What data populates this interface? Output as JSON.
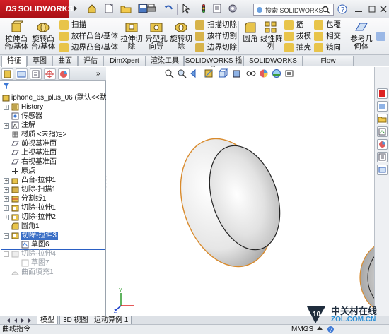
{
  "app": {
    "logo_ds": "DS",
    "logo_name": "SOLIDWORKS"
  },
  "search": {
    "placeholder": "搜索 SOLIDWORKS"
  },
  "ribbon": {
    "extrude_boss": "拉伸凸\n台/基体",
    "revolve_boss": "旋转凸\n台/基体",
    "sweep": "扫描",
    "loft": "放样凸台/基体",
    "boundary_boss": "边界凸台/基体",
    "extrude_cut": "拉伸切\n除",
    "hole_wizard": "异型孔\n向导",
    "revolve_cut": "旋转切\n除",
    "swept_cut": "扫描切除",
    "lofted_cut": "放样切割",
    "boundary_cut": "边界切除",
    "fillet": "圆角",
    "linear_pattern": "线性阵\n列",
    "rib": "筋",
    "draft": "拔模",
    "shell": "抽壳",
    "wrap": "包覆",
    "intersect": "相交",
    "mirror": "镜向",
    "ref_geometry": "参考几\n何体"
  },
  "tabs": [
    "特征",
    "草图",
    "曲面",
    "评估",
    "DimXpert",
    "渲染工具",
    "SOLIDWORKS 插件",
    "SOLIDWORKS MBD",
    "Flow Simulation"
  ],
  "tree": {
    "root": "iphone_6s_plus_06  (默认<<默认",
    "items": [
      {
        "label": "History",
        "icon": "history-icon"
      },
      {
        "label": "传感器",
        "icon": "sensor-icon"
      },
      {
        "label": "注解",
        "icon": "annotation-icon"
      },
      {
        "label": "材质 <未指定>",
        "icon": "material-icon"
      },
      {
        "label": "前视基准面",
        "icon": "plane-icon"
      },
      {
        "label": "上视基准面",
        "icon": "plane-icon"
      },
      {
        "label": "右视基准面",
        "icon": "plane-icon"
      },
      {
        "label": "原点",
        "icon": "origin-icon"
      },
      {
        "label": "凸台-拉伸1",
        "icon": "extrude-icon"
      },
      {
        "label": "切除-扫描1",
        "icon": "sweep-cut-icon"
      },
      {
        "label": "分割线1",
        "icon": "split-line-icon"
      },
      {
        "label": "切除-拉伸1",
        "icon": "cut-extrude-icon"
      },
      {
        "label": "切除-拉伸2",
        "icon": "cut-extrude-icon"
      },
      {
        "label": "圆角1",
        "icon": "fillet-icon"
      },
      {
        "label": "切除-拉伸3",
        "icon": "cut-extrude-icon"
      },
      {
        "label": "草图6",
        "icon": "sketch-icon"
      },
      {
        "label": "切除-拉伸4",
        "icon": "cut-extrude-icon"
      },
      {
        "label": "草图7",
        "icon": "sketch-icon"
      },
      {
        "label": "曲面填充1",
        "icon": "fill-surface-icon"
      }
    ]
  },
  "bottom_tabs": [
    "模型",
    "3D 视图",
    "运动算例 1"
  ],
  "status": {
    "left": "曲线指令",
    "units": "MMGS"
  },
  "watermark": {
    "brand": "中关村在线",
    "url": "ZOL.COM.CN",
    "number": "10"
  }
}
